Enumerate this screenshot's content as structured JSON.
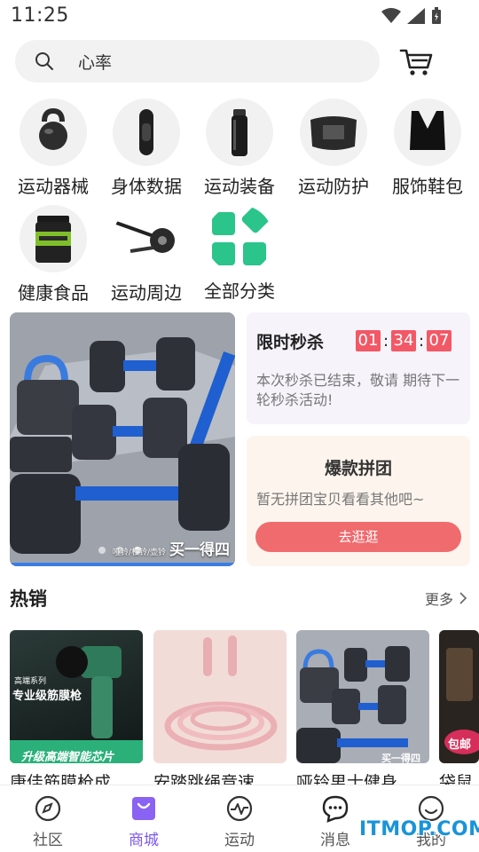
{
  "status_bar": {
    "time": "11:25"
  },
  "search": {
    "text": "心率"
  },
  "categories": [
    {
      "label": "运动器械",
      "icon": "kettlebell-icon"
    },
    {
      "label": "身体数据",
      "icon": "fitness-band-icon"
    },
    {
      "label": "运动装备",
      "icon": "bottle-icon"
    },
    {
      "label": "运动防护",
      "icon": "waist-support-icon"
    },
    {
      "label": "服饰鞋包",
      "icon": "sports-bra-icon"
    },
    {
      "label": "健康食品",
      "icon": "protein-tub-icon"
    },
    {
      "label": "运动周边",
      "icon": "ab-roller-icon"
    },
    {
      "label": "全部分类",
      "icon": "all-categories-icon"
    }
  ],
  "banner": {
    "caption": "买一得四",
    "sub_caption": "哑铃/杠铃/壶铃",
    "slide_count": 3,
    "active_slide": 3
  },
  "flash_sale": {
    "title": "限时秒杀",
    "hours": "01",
    "minutes": "34",
    "seconds": "07",
    "separator": ":",
    "message": "本次秒杀已结束，敬请 期待下一轮秒杀活动!"
  },
  "group_buy": {
    "title": "爆款拼团",
    "message": "暂无拼团宝贝看看其他吧~",
    "button": "去逛逛"
  },
  "hot": {
    "title": "热销",
    "more": "更多",
    "products": [
      {
        "name": "康佳筋膜枪成",
        "img_texts": [
          "高端系列",
          "专业级筋膜枪",
          "升级高端智能芯片"
        ]
      },
      {
        "name": "安踏跳绳竞速"
      },
      {
        "name": "哑铃男士健身",
        "img_texts": [
          "买一得四"
        ]
      },
      {
        "name": "袋鼠",
        "img_texts": [
          "包邮"
        ]
      }
    ]
  },
  "tabs": [
    {
      "label": "社区",
      "icon": "compass-icon"
    },
    {
      "label": "商城",
      "icon": "shop-bag-icon"
    },
    {
      "label": "运动",
      "icon": "pulse-icon"
    },
    {
      "label": "消息",
      "icon": "chat-bubble-icon"
    },
    {
      "label": "我的",
      "icon": "smile-icon"
    }
  ],
  "active_tab": "商城",
  "watermark": "ITMOP.COM",
  "colors": {
    "accent": "#7a57f0",
    "countdown": "#f25866",
    "group_button": "#f06b6e",
    "category_green": "#2bc48a"
  }
}
